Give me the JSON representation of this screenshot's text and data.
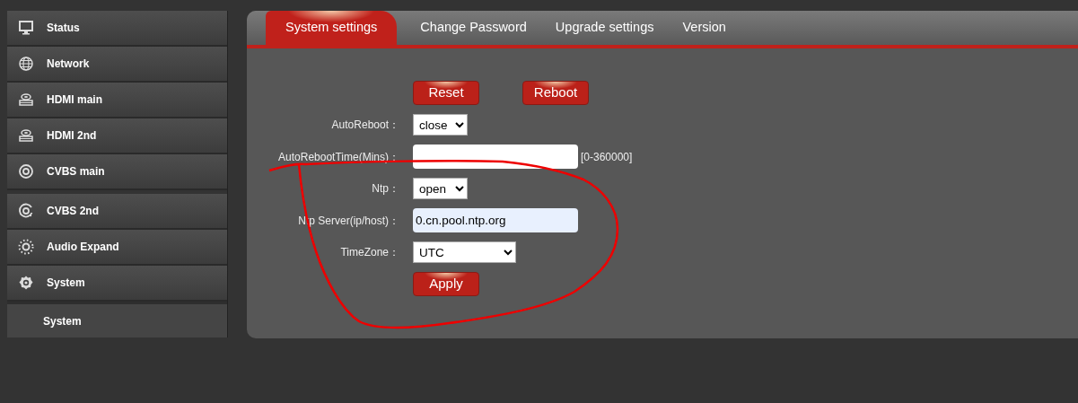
{
  "sidebar": {
    "items": [
      {
        "label": "Status",
        "kind": "menu"
      },
      {
        "label": "Network",
        "kind": "menu"
      },
      {
        "label": "HDMI main",
        "kind": "menu"
      },
      {
        "label": "HDMI 2nd",
        "kind": "menu"
      },
      {
        "label": "CVBS main",
        "kind": "menu"
      },
      {
        "label": "CVBS 2nd",
        "kind": "menu"
      },
      {
        "label": "Audio Expand",
        "kind": "menu"
      },
      {
        "label": "System",
        "kind": "menu"
      },
      {
        "label": "System",
        "kind": "submenu"
      }
    ]
  },
  "tabs": [
    {
      "label": "System settings",
      "selected": true
    },
    {
      "label": "Change Password",
      "selected": false
    },
    {
      "label": "Upgrade settings",
      "selected": false
    },
    {
      "label": "Version",
      "selected": false
    }
  ],
  "actions": [
    "Reset",
    "Reboot"
  ],
  "form": [
    {
      "kind": "select",
      "label": "AutoReboot：",
      "value": "close"
    },
    {
      "kind": "input",
      "label": "AutoRebootTime(Mins)：",
      "hint": "[0-360000]"
    },
    {
      "kind": "select",
      "label": "Ntp：",
      "value": "open"
    },
    {
      "kind": "input",
      "label": "Ntp Server(ip/host)：",
      "value": "0.cn.pool.ntp.org",
      "autofilled": true
    },
    {
      "kind": "select",
      "label": "TimeZone：",
      "value": "UTC",
      "wide": true
    }
  ],
  "apply_button": "Apply",
  "annotation": {
    "kind": "freehand-loop"
  }
}
